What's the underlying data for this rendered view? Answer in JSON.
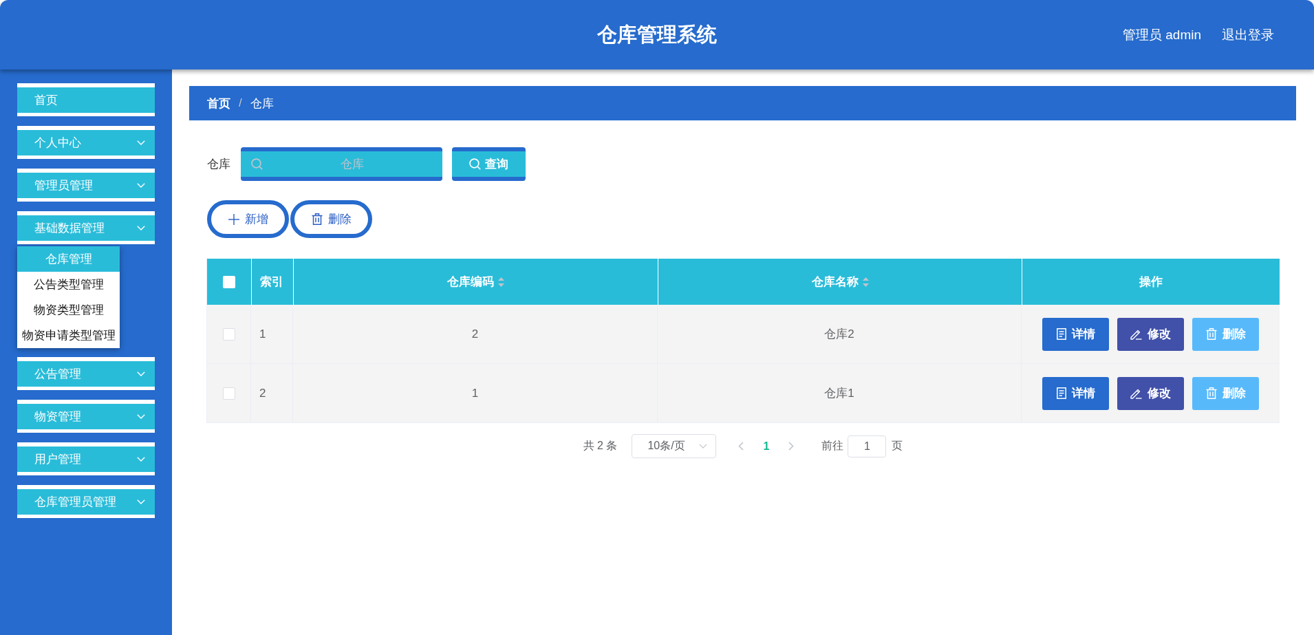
{
  "header": {
    "title": "仓库管理系统",
    "user": "管理员 admin",
    "logout": "退出登录"
  },
  "sidebar": {
    "items": [
      {
        "label": "首页",
        "kind": "link"
      },
      {
        "label": "个人中心",
        "kind": "submenu"
      },
      {
        "label": "管理员管理",
        "kind": "submenu"
      },
      {
        "label": "基础数据管理",
        "kind": "submenu",
        "children": [
          {
            "label": "仓库管理",
            "selected": true
          },
          {
            "label": "公告类型管理",
            "selected": false
          },
          {
            "label": "物资类型管理",
            "selected": false
          },
          {
            "label": "物资申请类型管理",
            "selected": false
          }
        ]
      },
      {
        "label": "公告管理",
        "kind": "submenu"
      },
      {
        "label": "物资管理",
        "kind": "submenu"
      },
      {
        "label": "用户管理",
        "kind": "submenu"
      },
      {
        "label": "仓库管理员管理",
        "kind": "submenu"
      }
    ]
  },
  "breadcrumb": {
    "separator": "/",
    "items": [
      {
        "label": "首页",
        "kind": "link"
      },
      {
        "label": "仓库",
        "kind": "current"
      }
    ]
  },
  "search": {
    "label": "仓库",
    "placeholder": "仓库",
    "button": "查询"
  },
  "actions": [
    {
      "label": "新增",
      "kind": "add"
    },
    {
      "label": "删除",
      "kind": "delete"
    }
  ],
  "table": {
    "all_checked": false,
    "columns": [
      {
        "label": "索引",
        "sortable": false
      },
      {
        "label": "仓库编码",
        "sortable": true
      },
      {
        "label": "仓库名称",
        "sortable": true
      },
      {
        "label": "操作",
        "sortable": false
      }
    ],
    "rows": [
      {
        "checked": false,
        "cells": [
          "1",
          "2",
          "仓库2"
        ],
        "actions": [
          {
            "label": "详情",
            "kind": "detail"
          },
          {
            "label": "修改",
            "kind": "edit"
          },
          {
            "label": "删除",
            "kind": "delete"
          }
        ]
      },
      {
        "checked": false,
        "cells": [
          "2",
          "1",
          "仓库1"
        ],
        "actions": [
          {
            "label": "详情",
            "kind": "detail"
          },
          {
            "label": "修改",
            "kind": "edit"
          },
          {
            "label": "删除",
            "kind": "delete"
          }
        ]
      }
    ]
  },
  "pagination": {
    "total": "共 2 条",
    "page_size": "10条/页",
    "pages": [
      {
        "label": "1",
        "selected": true
      }
    ],
    "goto_label": "前往",
    "goto_value": "1",
    "goto_suffix": "页"
  }
}
